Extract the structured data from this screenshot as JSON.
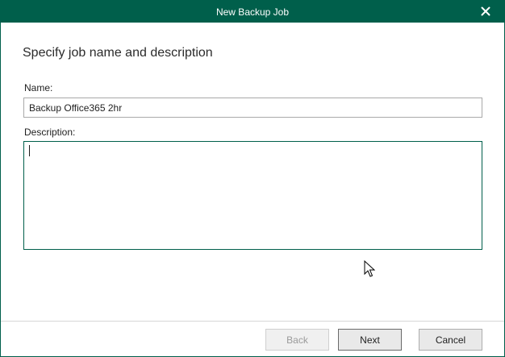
{
  "window": {
    "title": "New Backup Job"
  },
  "page": {
    "heading": "Specify job name and description"
  },
  "form": {
    "name_label": "Name:",
    "name_value": "Backup Office365 2hr",
    "description_label": "Description:",
    "description_value": ""
  },
  "buttons": {
    "back_label": "Back",
    "next_label": "Next",
    "cancel_label": "Cancel"
  },
  "icons": {
    "close": "close-icon",
    "cursor": "mouse-pointer-icon"
  },
  "colors": {
    "accent": "#005f4b",
    "title_text": "#ffffff"
  }
}
